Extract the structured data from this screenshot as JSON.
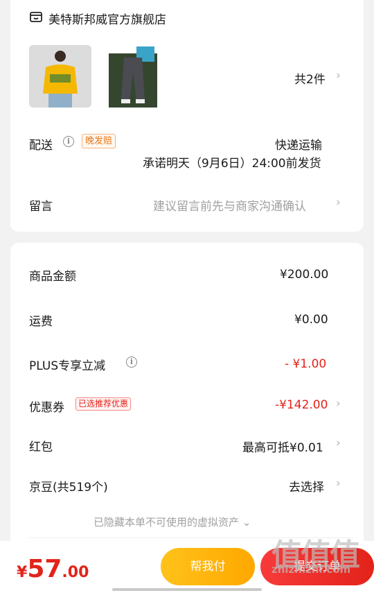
{
  "store": {
    "name": "美特斯邦威官方旗舰店",
    "icon": "store-icon"
  },
  "items": {
    "count_label": "共2件"
  },
  "delivery": {
    "label": "配送",
    "tag": "晚发赔",
    "method": "快递运输",
    "promise": "承诺明天（9月6日）24:00前发货"
  },
  "message": {
    "label": "留言",
    "placeholder": "建议留言前先与商家沟通确认"
  },
  "summary": {
    "goods_label": "商品金额",
    "goods_value": "¥200.00",
    "shipping_label": "运费",
    "shipping_value": "¥0.00",
    "plus_label": "PLUS专享立减",
    "plus_value": "- ¥1.00",
    "coupon_label": "优惠券",
    "coupon_tag": "已选推荐优惠",
    "coupon_value": "-¥142.00",
    "redpacket_label": "红包",
    "redpacket_value": "最高可抵¥0.01",
    "jingdou_label": "京豆(共519个)",
    "jingdou_value": "去选择",
    "hidden_note": "已隐藏本单不可使用的虚拟资产"
  },
  "footer": {
    "currency": "¥",
    "price_int": "57",
    "price_dec": ".00",
    "help_pay_label": "帮我付",
    "submit_label": "提交订单"
  },
  "watermark": {
    "cn": "值值值",
    "en": "zhizhizhi.com"
  },
  "colors": {
    "accent_red": "#e2231a",
    "help_pay_yellow": "#ffb300",
    "tag_orange": "#e87a1c"
  }
}
